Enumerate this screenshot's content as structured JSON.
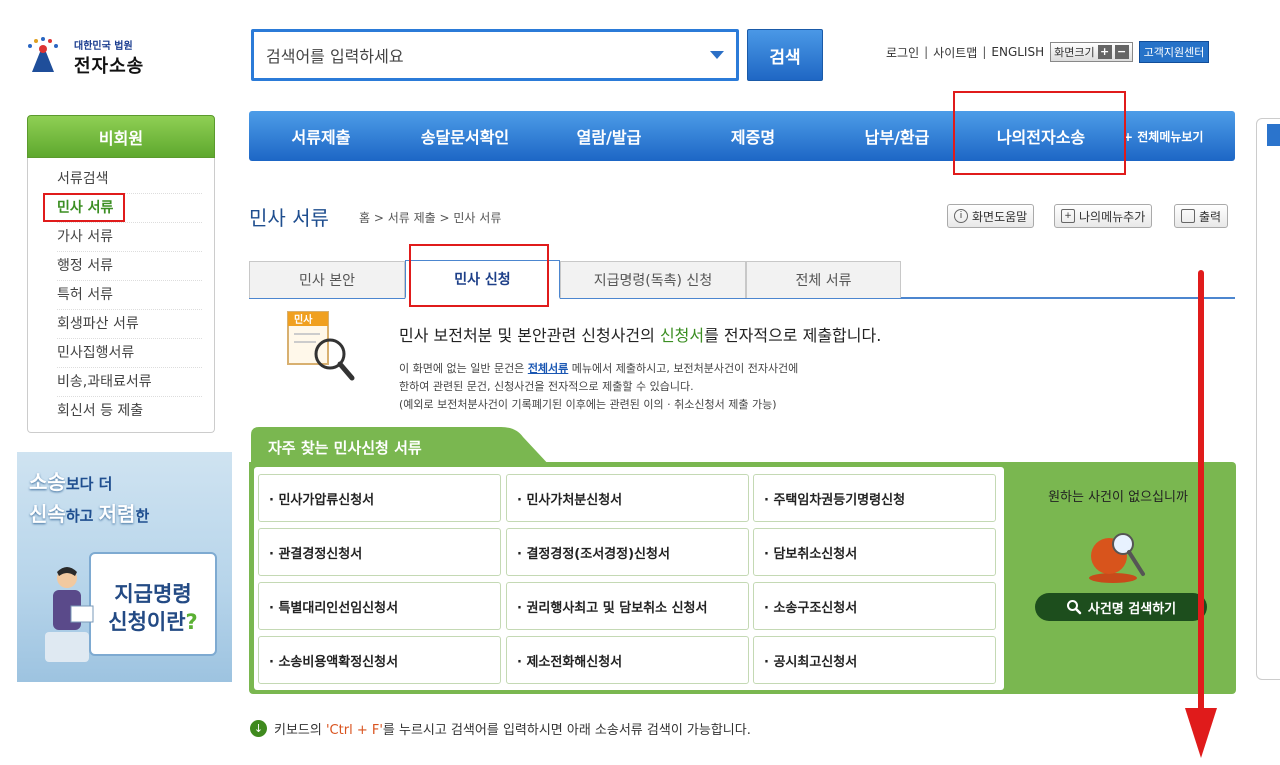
{
  "logo": {
    "small": "대한민국 법원",
    "big": "전자소송"
  },
  "search": {
    "placeholder": "검색어를 입력하세요",
    "button": "검색"
  },
  "util": {
    "login": "로그인",
    "sitemap": "사이트맵",
    "english": "ENGLISH",
    "zoom_label": "화면크기",
    "zoom_in": "+",
    "zoom_out": "−",
    "support": "고객지원센터"
  },
  "nav": {
    "items": [
      "서류제출",
      "송달문서확인",
      "열람/발급",
      "제증명",
      "납부/환급",
      "나의전자소송"
    ],
    "all_menu": "+ 전체메뉴보기"
  },
  "sidebar": {
    "heading": "비회원",
    "items": [
      "서류검색",
      "민사 서류",
      "가사 서류",
      "행정 서류",
      "특허 서류",
      "회생파산 서류",
      "민사집행서류",
      "비송,과태료서류",
      "회신서 등 제출"
    ]
  },
  "banner": {
    "line1_a": "소송",
    "line1_b": "보다 더",
    "line2_a": "신속",
    "line2_b": "하고 ",
    "line2_c": "저렴",
    "line2_d": "한",
    "card1": "지급명령",
    "card2": "신청이란"
  },
  "page": {
    "title": "민사 서류",
    "breadcrumb": "홈 > 서류 제출 > 민사 서류",
    "help_btn": "화면도움말",
    "mymenu_btn": "나의메뉴추가",
    "print_btn": "출력"
  },
  "tabs": [
    "민사 본안",
    "민사 신청",
    "지급명령(독촉) 신청",
    "전체 서류"
  ],
  "info": {
    "icon_label": "민사",
    "head_a": "민사 보전처분 및 본안관련 신청사건의 ",
    "head_hl": "신청서",
    "head_b": "를 전자적으로 제출합니다.",
    "p1_a": "이 화면에 없는 일반 문건은 ",
    "p1_link": "전체서류",
    "p1_b": " 메뉴에서 제출하시고, 보전처분사건이 전자사건에",
    "p2": "한하여 관련된 문건, 신청사건을 전자적으로 제출할 수 있습니다.",
    "p3": "(예외로 보전처분사건이 기록폐기된 이후에는 관련된 이의 · 취소신청서 제출 가능)"
  },
  "frequent": {
    "title": "자주 찾는 민사신청 서류",
    "items": [
      "· 민사가압류신청서",
      "· 민사가처분신청서",
      "· 주택임차권등기명령신청",
      "· 관결경정신청서",
      "· 결정경정(조서경정)신청서",
      "· 담보취소신청서",
      "· 특별대리인선임신청서",
      "· 권리행사최고 및 담보취소 신청서",
      "· 소송구조신청서",
      "· 소송비용액확정신청서",
      "· 제소전화해신청서",
      "· 공시최고신청서"
    ],
    "no_case_text": "원하는 사건이 없으십니까",
    "case_search_btn": "사건명 검색하기"
  },
  "hint": {
    "a": "키보드의 ",
    "key": "'Ctrl + F'",
    "b": "를 누르시고 검색어를 입력하시면 아래 소송서류 검색이 가능합니다."
  },
  "colors": {
    "nav_blue": "#1d66c5",
    "green": "#7ab750",
    "annotation_red": "#e01b1b"
  }
}
